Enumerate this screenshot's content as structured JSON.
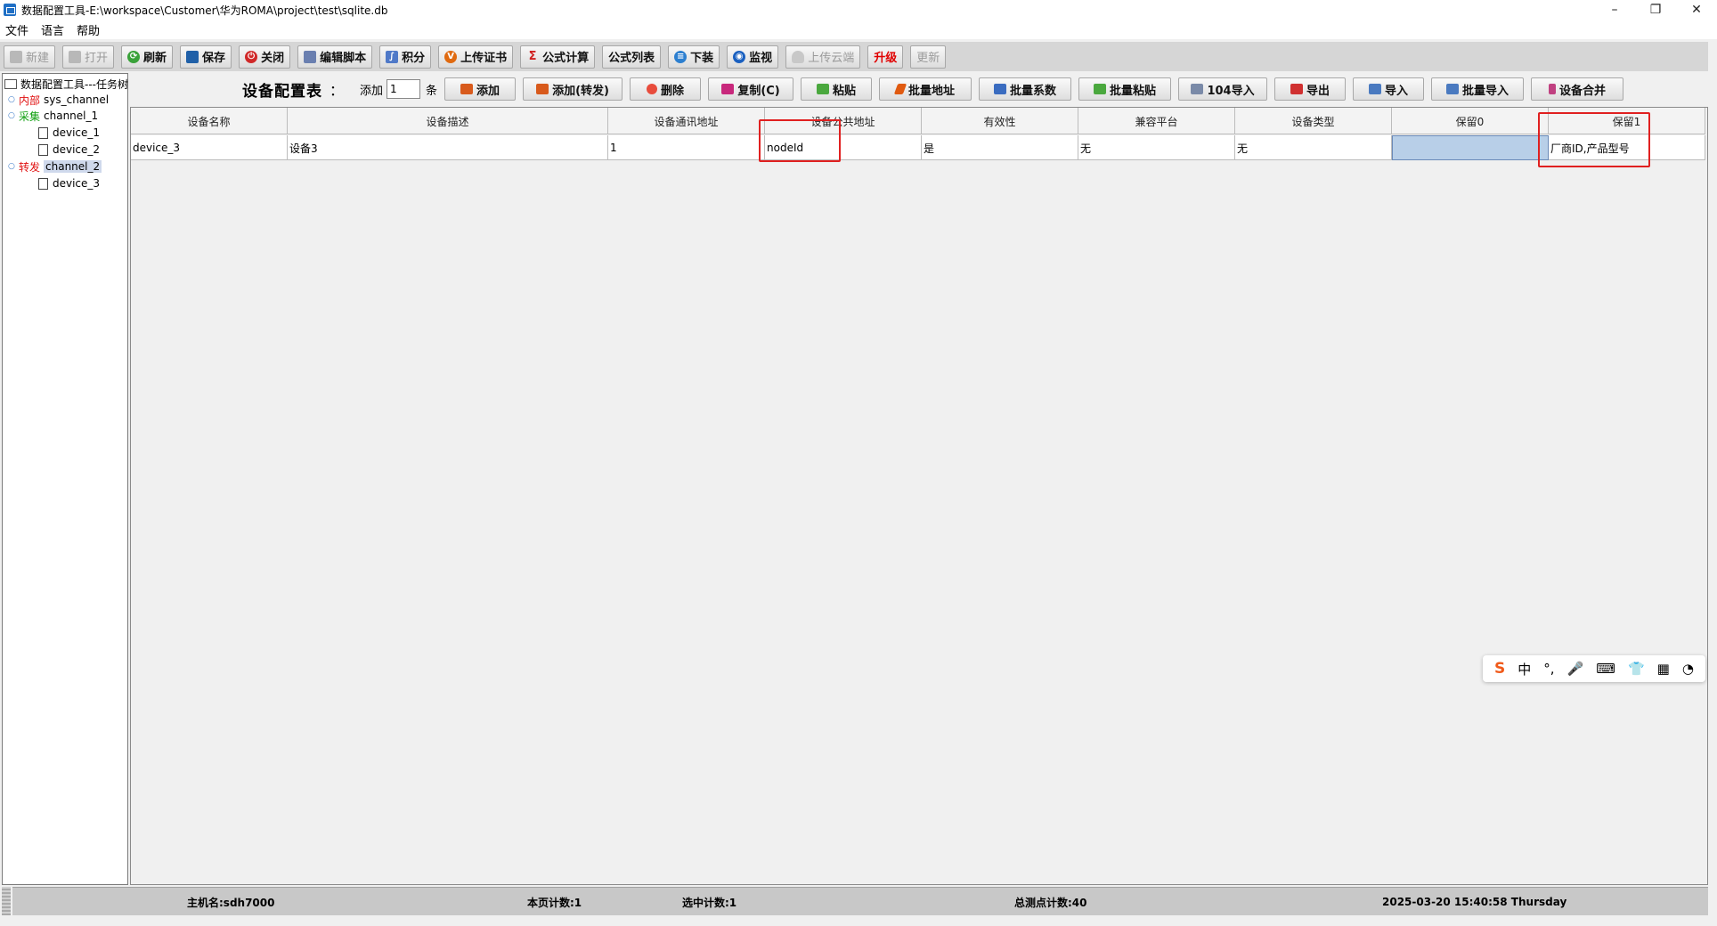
{
  "window": {
    "title": "数据配置工具-E:\\workspace\\Customer\\华为ROMA\\project\\test\\sqlite.db",
    "minimize": "–",
    "maximize": "❐",
    "close": "✕"
  },
  "menu": [
    "文件",
    "语言",
    "帮助"
  ],
  "toolbar": {
    "new": "新建",
    "open": "打开",
    "refresh": "刷新",
    "save": "保存",
    "close": "关闭",
    "edit_script": "编辑脚本",
    "integral": "积分",
    "upload_cert": "上传证书",
    "formula_calc": "公式计算",
    "formula_list": "公式列表",
    "download": "下装",
    "monitor": "监视",
    "upload_cloud": "上传云端",
    "upgrade": "升级",
    "update": "更新"
  },
  "tree": {
    "root": "数据配置工具---任务树",
    "nodes": [
      {
        "tag": "内部",
        "label": "sys_channel"
      },
      {
        "tag": "采集",
        "label": "channel_1",
        "children": [
          "device_1",
          "device_2"
        ]
      },
      {
        "tag": "转发",
        "label": "channel_2",
        "children": [
          "device_3"
        ]
      }
    ]
  },
  "table_toolbar": {
    "title": "设备配置表",
    "colon": "：",
    "add_label": "添加",
    "count_value": "1",
    "unit": "条",
    "buttons": {
      "add": "添加",
      "add_forward": "添加(转发)",
      "delete": "删除",
      "copy": "复制(C)",
      "paste": "粘贴",
      "batch_address": "批量地址",
      "batch_coef": "批量系数",
      "batch_paste": "批量粘贴",
      "import_104": "104导入",
      "export": "导出",
      "import": "导入",
      "batch_import": "批量导入",
      "merge": "设备合并"
    }
  },
  "grid": {
    "columns": [
      "设备名称",
      "设备描述",
      "设备通讯地址",
      "设备公共地址",
      "有效性",
      "兼容平台",
      "设备类型",
      "保留0",
      "保留1"
    ],
    "rows": [
      [
        "device_3",
        "设备3",
        "1",
        "nodeId",
        "是",
        "无",
        "无",
        "",
        "厂商ID,产品型号"
      ]
    ]
  },
  "ime": {
    "logo": "S",
    "mode": "中",
    "punct": "°,",
    "mic": "🎤",
    "keyboard": "⌨",
    "skin": "👕",
    "apps": "▦",
    "more": "◔"
  },
  "status": {
    "host": "主机名:sdh7000",
    "page_count": "本页计数:1",
    "selected_count": "选中计数:1",
    "total_points": "总测点计数:40",
    "datetime": "2025-03-20 15:40:58 Thursday"
  }
}
